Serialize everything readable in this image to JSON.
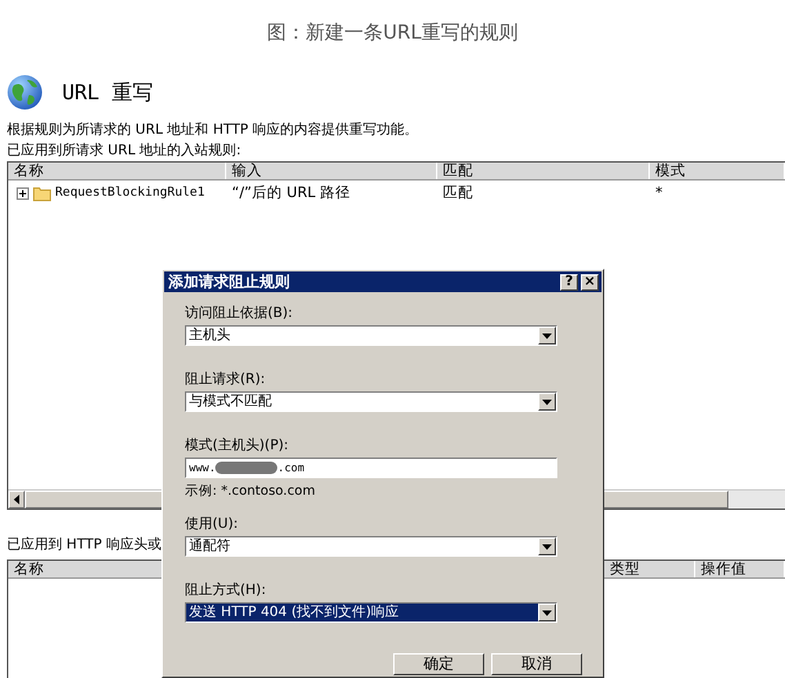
{
  "caption": "图：新建一条URL重写的规则",
  "page": {
    "title": "URL 重写",
    "description": "根据规则为所请求的 URL 地址和 HTTP 响应的内容提供重写功能。",
    "inbound": {
      "label": "已应用到所请求 URL 地址的入站规则:",
      "columns": [
        "名称",
        "输入",
        "匹配",
        "模式"
      ],
      "rows": [
        {
          "expanded": false,
          "cells": [
            "RequestBlockingRule1",
            "“/”后的 URL 路径",
            "匹配",
            "*"
          ]
        }
      ]
    },
    "outbound": {
      "label": "已应用到 HTTP 响应头或",
      "columns": [
        "名称",
        "类型",
        "操作值"
      ]
    }
  },
  "dialog": {
    "title": "添加请求阻止规则",
    "title_buttons": [
      "?",
      "×"
    ],
    "fields": [
      {
        "kind": "dropdown",
        "label": "访问阻止依据(B):",
        "value": "主机头",
        "focused": false
      },
      {
        "kind": "dropdown",
        "label": "阻止请求(R):",
        "value": "与模式不匹配",
        "focused": false
      },
      {
        "kind": "text",
        "label": "模式(主机头)(P):",
        "value": "www.",
        "value_end": ".com",
        "redacted": true,
        "example": "示例: *.contoso.com"
      },
      {
        "kind": "dropdown",
        "label": "使用(U):",
        "value": "通配符",
        "focused": false
      },
      {
        "kind": "dropdown",
        "label": "阻止方式(H):",
        "value": "发送 HTTP 404 (找不到文件)响应",
        "focused": true
      }
    ],
    "buttons": [
      "确定",
      "取消"
    ]
  }
}
